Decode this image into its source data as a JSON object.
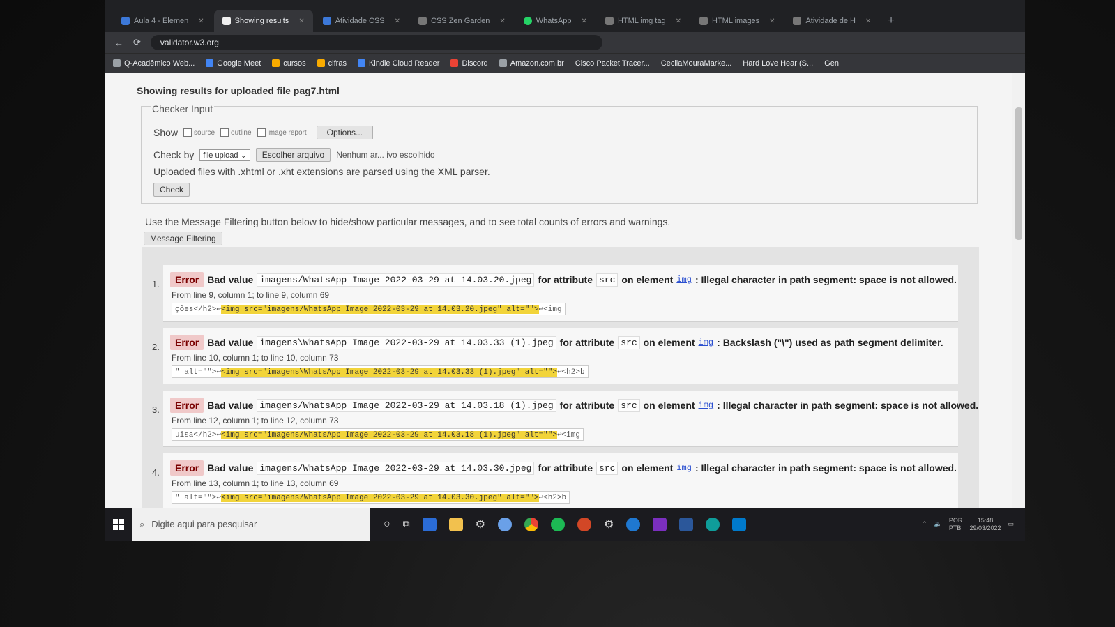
{
  "browser": {
    "tabs": [
      {
        "label": "Aula 4 - Elemen",
        "active": false,
        "icon": "blue-square-icon"
      },
      {
        "label": "Showing results",
        "active": true,
        "icon": "validator-icon"
      },
      {
        "label": "Atividade CSS",
        "active": false,
        "icon": "blue-square-icon"
      },
      {
        "label": "CSS Zen Garden",
        "active": false,
        "icon": "grey-square-icon"
      },
      {
        "label": "WhatsApp",
        "active": false,
        "icon": "whatsapp-icon"
      },
      {
        "label": "HTML img tag",
        "active": false,
        "icon": "grey-square-icon"
      },
      {
        "label": "HTML images",
        "active": false,
        "icon": "grey-square-icon"
      },
      {
        "label": "Atividade de H",
        "active": false,
        "icon": "grey-square-icon"
      }
    ],
    "url": "validator.w3.org",
    "bookmarks": [
      {
        "label": "Q-Acadêmico Web...",
        "icon": "grey"
      },
      {
        "label": "Google Meet",
        "icon": "blue"
      },
      {
        "label": "cursos",
        "icon": "folder"
      },
      {
        "label": "cifras",
        "icon": "folder"
      },
      {
        "label": "Kindle Cloud Reader",
        "icon": "blue"
      },
      {
        "label": "Discord",
        "icon": "red"
      },
      {
        "label": "Amazon.com.br",
        "icon": "grey"
      },
      {
        "label": "Cisco Packet Tracer...",
        "icon": "grey"
      },
      {
        "label": "CecilaMouraMarke...",
        "icon": "grey"
      },
      {
        "label": "Hard Love Hear (S...",
        "icon": "grey"
      },
      {
        "label": "Gen",
        "icon": "grey"
      }
    ]
  },
  "page": {
    "heading": "Showing results for uploaded file pag7.html",
    "checker": {
      "legend": "Checker Input",
      "show_label": "Show",
      "options": [
        "source",
        "outline",
        "image report"
      ],
      "options_button": "Options...",
      "checkby_label": "Check by",
      "checkby_value": "file upload",
      "file_button": "Escolher arquivo",
      "file_status": "Nenhum ar... ivo escolhido",
      "xml_note": "Uploaded files with .xhtml or .xht extensions are parsed using the XML parser.",
      "check_button": "Check"
    },
    "filter_note": "Use the Message Filtering button below to hide/show particular messages, and to see total counts of errors and warnings.",
    "filter_button": "Message Filtering",
    "messages": [
      {
        "num": "1.",
        "type": "Error",
        "bad_value_label": "Bad value",
        "value": "imagens/WhatsApp Image 2022-03-29 at 14.03.20.jpeg",
        "for_attr": "for attribute",
        "attr": "src",
        "on_el": "on element",
        "element": "img",
        "desc": ": Illegal character in path segment: space is not allowed.",
        "location": "From line 9, column 1; to line 9, column 69",
        "ext_before": "ções</h2>↩",
        "ext_hl": "<img src=\"imagens/WhatsApp Image 2022-03-29 at 14.03.20.jpeg\" alt=\"\">",
        "ext_after": "↩<img"
      },
      {
        "num": "2.",
        "type": "Error",
        "bad_value_label": "Bad value",
        "value": "imagens\\WhatsApp Image 2022-03-29 at 14.03.33 (1).jpeg",
        "for_attr": "for attribute",
        "attr": "src",
        "on_el": "on element",
        "element": "img",
        "desc": ": Backslash (\"\\\") used as path segment delimiter.",
        "location": "From line 10, column 1; to line 10, column 73",
        "ext_before": "\" alt=\"\">↩",
        "ext_hl": "<img src=\"imagens\\WhatsApp Image 2022-03-29 at 14.03.33 (1).jpeg\" alt=\"\">",
        "ext_after": "↩<h2>b"
      },
      {
        "num": "3.",
        "type": "Error",
        "bad_value_label": "Bad value",
        "value": "imagens/WhatsApp Image 2022-03-29 at 14.03.18 (1).jpeg",
        "for_attr": "for attribute",
        "attr": "src",
        "on_el": "on element",
        "element": "img",
        "desc": ": Illegal character in path segment: space is not allowed.",
        "location": "From line 12, column 1; to line 12, column 73",
        "ext_before": "uisa</h2>↩",
        "ext_hl": "<img src=\"imagens/WhatsApp Image 2022-03-29 at 14.03.18 (1).jpeg\" alt=\"\">",
        "ext_after": "↩<img"
      },
      {
        "num": "4.",
        "type": "Error",
        "bad_value_label": "Bad value",
        "value": "imagens/WhatsApp Image 2022-03-29 at 14.03.30.jpeg",
        "for_attr": "for attribute",
        "attr": "src",
        "on_el": "on element",
        "element": "img",
        "desc": ": Illegal character in path segment: space is not allowed.",
        "location": "From line 13, column 1; to line 13, column 69",
        "ext_before": "\" alt=\"\">↩",
        "ext_hl": "<img src=\"imagens/WhatsApp Image 2022-03-29 at 14.03.30.jpeg\" alt=\"\">",
        "ext_after": "↩<h2>b"
      }
    ]
  },
  "taskbar": {
    "search_placeholder": "Digite aqui para pesquisar",
    "language": "POR",
    "layout": "PTB",
    "time": "15:48",
    "date": "29/03/2022"
  },
  "colors": {
    "error_badge_bg": "#f0c9c9",
    "highlight": "#f2d43a",
    "link": "#2a4fd0",
    "tab_strip": "#202124"
  }
}
